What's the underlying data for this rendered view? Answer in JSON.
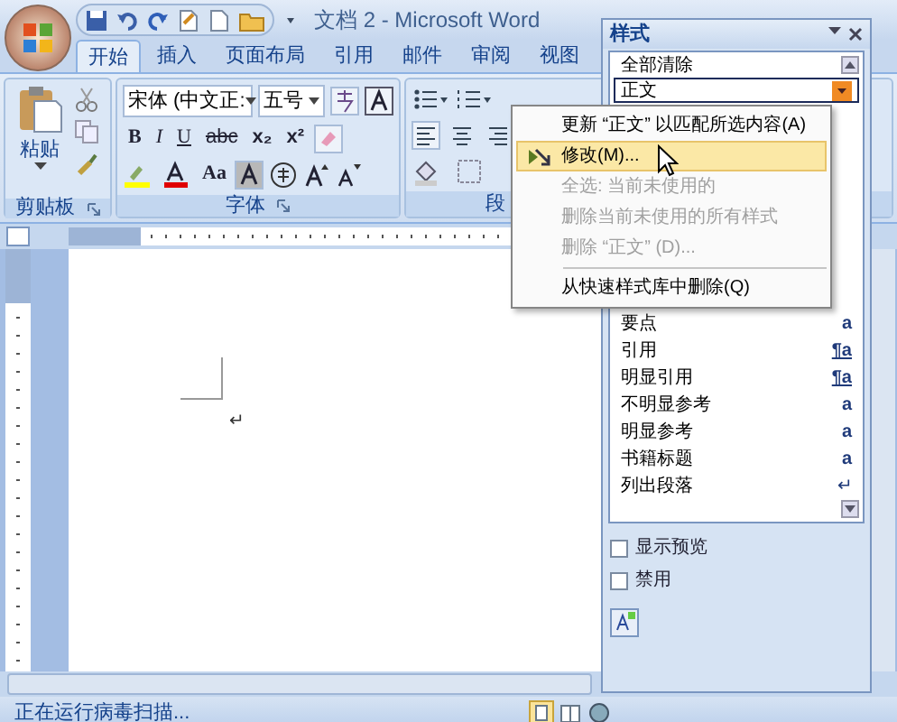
{
  "title_bar": {
    "title": "文档 2 - Microsoft Word"
  },
  "tabs": [
    {
      "label": "开始",
      "selected": true
    },
    {
      "label": "插入",
      "selected": false
    },
    {
      "label": "页面布局",
      "selected": false
    },
    {
      "label": "引用",
      "selected": false
    },
    {
      "label": "邮件",
      "selected": false
    },
    {
      "label": "审阅",
      "selected": false
    },
    {
      "label": "视图",
      "selected": false
    }
  ],
  "ribbon": {
    "clipboard": {
      "paste_label": "粘贴",
      "group_label": "剪贴板"
    },
    "font": {
      "font_name": "宋体 (中文正:",
      "font_size": "五号",
      "row2": [
        "B",
        "I",
        "U",
        "abc",
        "x₂",
        "x²"
      ],
      "case_label": "Aa",
      "group_label": "字体"
    },
    "paragraph": {
      "group_label": "段"
    }
  },
  "styles_pane": {
    "title": "样式",
    "items": [
      {
        "name": "全部清除",
        "selected": false
      },
      {
        "name": "正文",
        "selected": true
      },
      {
        "name": "要点",
        "selected": false,
        "kind": "char",
        "symbol": "a"
      },
      {
        "name": "引用",
        "selected": false,
        "kind": "linked",
        "symbol": "¶a"
      },
      {
        "name": "明显引用",
        "selected": false,
        "kind": "linked",
        "symbol": "¶a"
      },
      {
        "name": "不明显参考",
        "selected": false,
        "kind": "char",
        "symbol": "a"
      },
      {
        "name": "明显参考",
        "selected": false,
        "kind": "char",
        "symbol": "a"
      },
      {
        "name": "书籍标题",
        "selected": false,
        "kind": "char",
        "symbol": "a"
      },
      {
        "name": "列出段落",
        "selected": false,
        "kind": "para",
        "symbol": "↵"
      }
    ],
    "checkboxes": [
      {
        "label": "显示预览",
        "checked": false
      },
      {
        "label": "禁用",
        "checked": false
      }
    ]
  },
  "context_menu": {
    "items": [
      {
        "kind": "item",
        "label": "更新 “正文” 以匹配所选内容(A)",
        "disabled": false,
        "selected": false
      },
      {
        "kind": "item",
        "label": "修改(M)...",
        "disabled": false,
        "selected": true
      },
      {
        "kind": "item",
        "label": "全选: 当前未使用的",
        "disabled": true,
        "selected": false
      },
      {
        "kind": "item",
        "label": "删除当前未使用的所有样式",
        "disabled": true,
        "selected": false
      },
      {
        "kind": "item",
        "label": "删除 “正文” (D)...",
        "disabled": true,
        "selected": false
      },
      {
        "kind": "separator"
      },
      {
        "kind": "item",
        "label": "从快速样式库中删除(Q)",
        "disabled": false,
        "selected": false
      }
    ]
  },
  "document": {
    "paragraph_mark": "↵"
  },
  "status_bar": {
    "text": "正在运行病毒扫描..."
  }
}
